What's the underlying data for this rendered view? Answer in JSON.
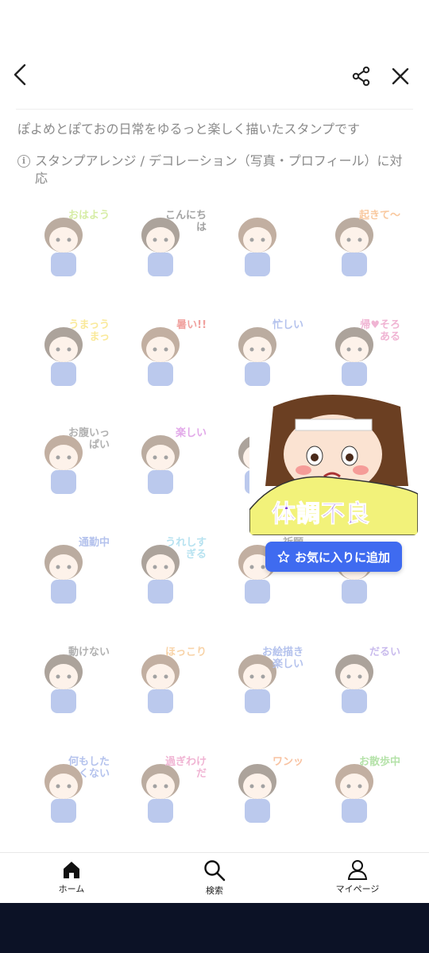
{
  "header": {
    "back_icon": "chevron-left-icon",
    "share_icon": "share-icon",
    "close_icon": "close-icon"
  },
  "description": "ぽよめとぽておの日常をゆるっと楽しく描いたスタンプです",
  "compat_note": "スタンプアレンジ / デコレーション（写真・プロフィール）に対応",
  "stickers": [
    {
      "text": "おはよう",
      "color": "#a6d93a"
    },
    {
      "text": "こんにちは",
      "color": "#333333"
    },
    {
      "text": "",
      "color": "#e7a3c8"
    },
    {
      "text": "起きて〜",
      "color": "#f28a2e"
    },
    {
      "text": "うまっうまっ",
      "color": "#f5d020"
    },
    {
      "text": "暑い!!",
      "color": "#e0302a"
    },
    {
      "text": "忙しい",
      "color": "#5a7ad8"
    },
    {
      "text": "帰♥そろある",
      "color": "#e05aa0"
    },
    {
      "text": "お腹いっぱい",
      "color": "#555555"
    },
    {
      "text": "楽しい",
      "color": "#c040d0"
    },
    {
      "text": "",
      "color": "#6a6a6a"
    },
    {
      "text": "",
      "color": "#ffffff"
    },
    {
      "text": "通勤中",
      "color": "#5a7ad8"
    },
    {
      "text": "うれしすぎる",
      "color": "#60c0e0"
    },
    {
      "text": "祈願",
      "color": "#555555"
    },
    {
      "text": "",
      "color": "#e77aa0"
    },
    {
      "text": "動けない",
      "color": "#555555"
    },
    {
      "text": "ほっこり",
      "color": "#f0a040"
    },
    {
      "text": "お絵描き楽しい",
      "color": "#5a7ad8"
    },
    {
      "text": "だるい",
      "color": "#8a6ad8"
    },
    {
      "text": "何もしたくない",
      "color": "#5a7ad8"
    },
    {
      "text": "過ぎわけだ",
      "color": "#e05aa0"
    },
    {
      "text": "ワンッ",
      "color": "#f07a30"
    },
    {
      "text": "お散歩中",
      "color": "#5ac040"
    }
  ],
  "preview": {
    "text": "体調不良",
    "bg_color": "#f2f27a",
    "text_color": "#7a3ad8"
  },
  "favorite_button": {
    "label": "お気に入りに追加",
    "icon": "star-outline-icon",
    "color": "#3f6bf0"
  },
  "tabbar": {
    "tabs": [
      {
        "label": "ホーム",
        "icon": "home-icon"
      },
      {
        "label": "検索",
        "icon": "search-icon"
      },
      {
        "label": "マイページ",
        "icon": "person-icon"
      }
    ]
  }
}
